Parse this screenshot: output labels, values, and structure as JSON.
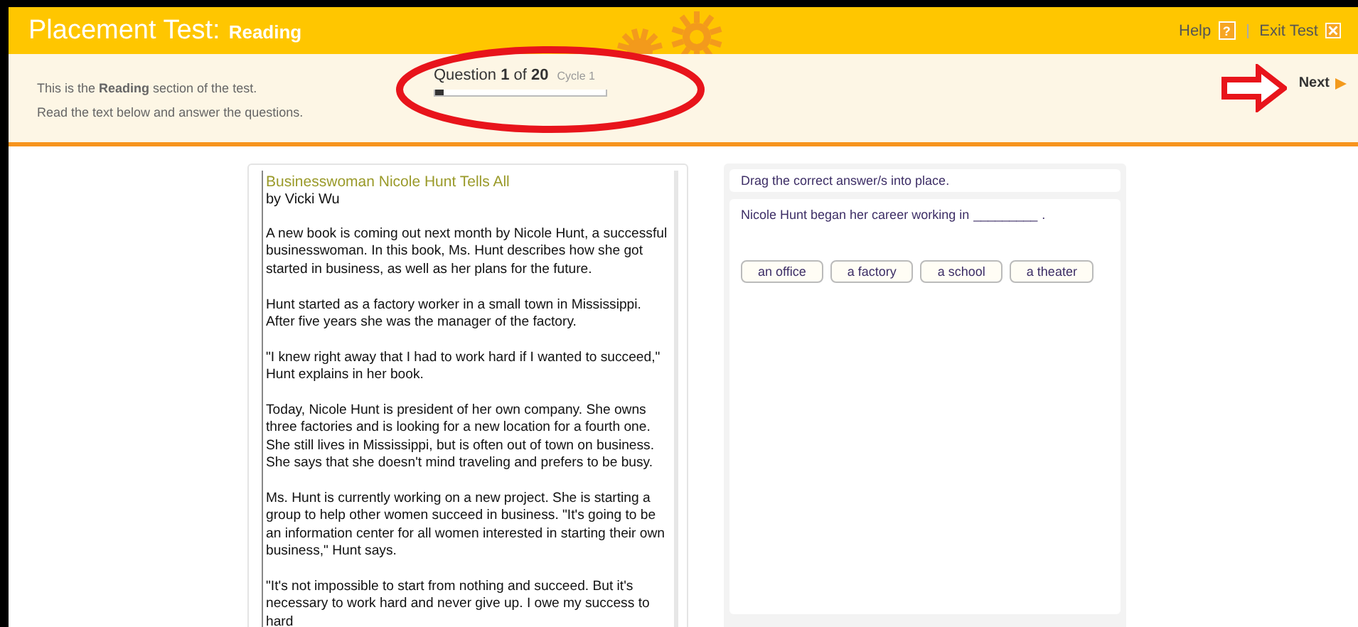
{
  "header": {
    "title": "Placement Test:",
    "section": "Reading",
    "help": "Help",
    "help_icon": "?",
    "exit": "Exit Test"
  },
  "intro": {
    "lines": [
      "This is the **Reading** section of the test.",
      "Read the text below and answer the questions."
    ]
  },
  "progress": {
    "label": "Question **1** of **20**",
    "cycle": "Cycle 1",
    "level": 0.05
  },
  "next": "Next",
  "passage": {
    "title": "Businesswoman Nicole Hunt Tells All",
    "byline": "by Vicki Wu",
    "paragraphs": [
      "A new book is coming out next month by Nicole Hunt, a successful businesswoman. In this book, Ms. Hunt describes how she got started in business, as well as her plans for the future.",
      "Hunt started as a factory worker in a small town in Mississippi. After five years she was the manager of the factory.",
      "\"I knew right away that I had to work hard if I wanted to succeed,\" Hunt explains in her book.",
      "Today, Nicole Hunt is president of her own company. She owns three factories and is looking for a new location for a fourth one. She still lives in Mississippi, but is often out of town on business. She says that she doesn't mind traveling and prefers to be busy.",
      "Ms. Hunt is currently working on a new project. She is starting a group to help other women succeed in business. \"It's going to be an information center for all women interested in starting their own business,\" Hunt says.",
      "\"It's not impossible to start from nothing and succeed. But it's necessary to work hard and never give up. I owe my success to hard"
    ]
  },
  "question": {
    "instruction": "Drag the correct answer/s into place.",
    "prompt": "Nicole Hunt began her career working in",
    "blank": "_________",
    "end": ".",
    "answers": [
      "an office",
      "a factory",
      "a school",
      "a theater"
    ]
  }
}
